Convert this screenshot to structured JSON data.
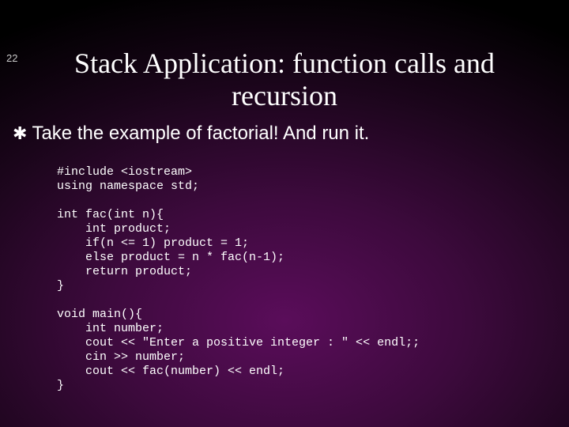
{
  "page_number": "22",
  "title_line1": "Stack Application: function calls and",
  "title_line2": "recursion",
  "bullet": {
    "icon": "✱",
    "text": "Take the example of factorial! And run it."
  },
  "code": "#include <iostream>\nusing namespace std;\n\nint fac(int n){\n    int product;\n    if(n <= 1) product = 1;\n    else product = n * fac(n-1);\n    return product;\n}\n\nvoid main(){\n    int number;\n    cout << \"Enter a positive integer : \" << endl;;\n    cin >> number;\n    cout << fac(number) << endl;\n}"
}
